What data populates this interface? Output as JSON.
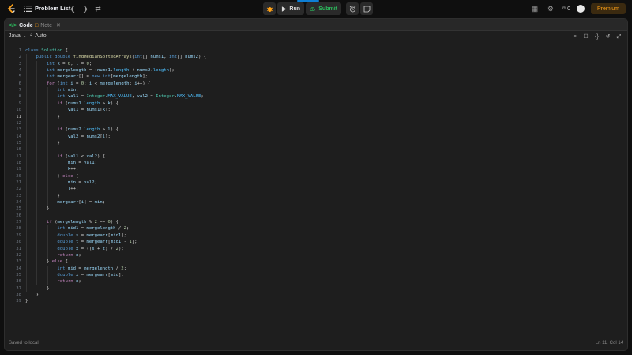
{
  "topbar": {
    "problem_list_label": "Problem List",
    "run_label": "Run",
    "submit_label": "Submit",
    "streak_count": "0",
    "premium_label": "Premium"
  },
  "tabs": [
    {
      "label": "Code",
      "active": true
    },
    {
      "label": "Note",
      "active": false
    }
  ],
  "toolbar": {
    "language": "Java",
    "mode": "Auto"
  },
  "editor": {
    "current_line": 11,
    "lines": [
      "class Solution {",
      "    public double findMedianSortedArrays(int[] nums1, int[] nums2) {",
      "        int k = 0, l = 0;",
      "        int mergelength = (nums1.length + nums2.length);",
      "        int mergearr[] = new int[mergelength];",
      "        for (int i = 0; i < mergelength; i++) {",
      "            int min;",
      "            int val1 = Integer.MAX_VALUE, val2 = Integer.MAX_VALUE;",
      "            if (nums1.length > k) {",
      "                val1 = nums1[k];",
      "            }",
      "",
      "            if (nums2.length > l) {",
      "                val2 = nums2[l];",
      "            }",
      "",
      "            if (val1 < val2) {",
      "                min = val1;",
      "                k++;",
      "            } else {",
      "                min = val2;",
      "                l++;",
      "            }",
      "            mergearr[i] = min;",
      "        }",
      "",
      "        if (mergelength % 2 == 0) {",
      "            int mid1 = mergelength / 2;",
      "            double s = mergearr[mid1];",
      "            double t = mergearr[mid1 - 1];",
      "            double x = ((s + t) / 2);",
      "            return x;",
      "        } else {",
      "            int mid = mergelength / 2;",
      "            double x = mergearr[mid];",
      "            return x;",
      "        }",
      "    }",
      "}"
    ]
  },
  "status": {
    "saved": "Saved to local",
    "position": "Ln 11, Col 14"
  },
  "colors": {
    "accent_run": "#dcdcdc",
    "accent_submit": "#2cbb5d",
    "premium": "#ffa116",
    "keyword": "#569cd6",
    "control_keyword": "#c586c0",
    "type": "#4ec9b0",
    "function": "#dcdcaa",
    "number": "#b5cea8",
    "variable": "#9cdcfe"
  }
}
